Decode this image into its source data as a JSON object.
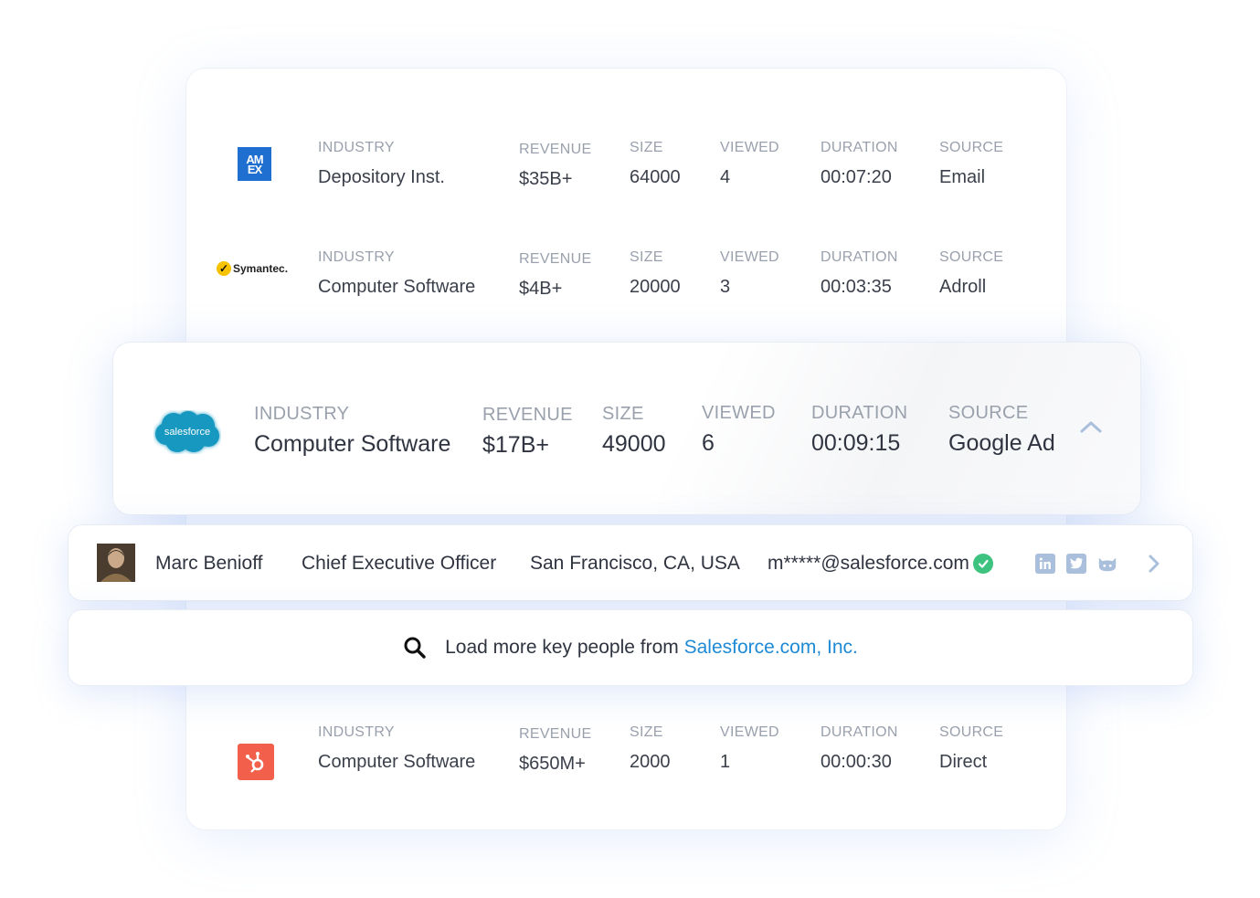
{
  "labels": {
    "industry": "INDUSTRY",
    "revenue": "REVENUE",
    "size": "SIZE",
    "viewed": "VIEWED",
    "duration": "DURATION",
    "source": "SOURCE"
  },
  "companies": [
    {
      "logo": "amex-logo",
      "logo_text_1": "AM",
      "logo_text_2": "EX",
      "industry": "Depository Inst.",
      "revenue": "$35B+",
      "size": "64000",
      "viewed": "4",
      "duration": "00:07:20",
      "source": "Email"
    },
    {
      "logo": "symantec-logo",
      "logo_text": "Symantec.",
      "industry": "Computer Software",
      "revenue": "$4B+",
      "size": "20000",
      "viewed": "3",
      "duration": "00:03:35",
      "source": "Adroll"
    },
    {
      "logo": "salesforce-logo",
      "logo_text": "salesforce",
      "industry": "Computer Software",
      "revenue": "$17B+",
      "size": "49000",
      "viewed": "6",
      "duration": "00:09:15",
      "source": "Google Ad"
    },
    {
      "logo": "hubspot-logo",
      "industry": "Computer Software",
      "revenue": "$650M+",
      "size": "2000",
      "viewed": "1",
      "duration": "00:00:30",
      "source": "Direct"
    }
  ],
  "person": {
    "name": "Marc Benioff",
    "title": "Chief Executive Officer",
    "location": "San Francisco, CA, USA",
    "email": "m*****@salesforce.com",
    "social_icons": [
      "linkedin-icon",
      "twitter-icon",
      "github-icon"
    ]
  },
  "load_more": {
    "text": "Load more key people from ",
    "company_link": "Salesforce.com, Inc."
  },
  "colors": {
    "accent_blue": "#1e8ad6",
    "salesforce_blue": "#1798c1",
    "amex_blue": "#1e6fd0",
    "hubspot_orange": "#f2604b",
    "verified_green": "#3dc37f",
    "social_gray_blue": "#a9bfdc"
  }
}
